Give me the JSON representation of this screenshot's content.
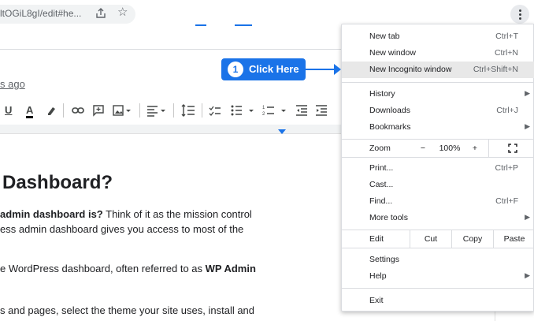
{
  "browser": {
    "url_text": "ltOGiL8gI/edit#he...",
    "share_icon": "share-icon",
    "star_icon": "star-icon",
    "menu_button_icon": "more-vert-icon"
  },
  "doc": {
    "edit_time": "s ago",
    "heading": "Dashboard?",
    "p1_bold": "admin dashboard is?",
    "p1_rest": " Think of it as the mission control",
    "p1_line2": "ess admin dashboard gives you access to most of the",
    "p2_start": "e WordPress dashboard, often referred to as ",
    "p2_bold": "WP Admin",
    "p3": "s and pages, select the theme your site uses, install and"
  },
  "toolbar_icons": [
    "underline-icon",
    "text-color-icon",
    "highlight-icon",
    "link-icon",
    "comment-icon",
    "image-icon",
    "align-icon",
    "line-spacing-icon",
    "checklist-icon",
    "bullet-list-icon",
    "numbered-list-icon",
    "decrease-indent-icon",
    "increase-indent-icon"
  ],
  "callout": {
    "number": "1",
    "text": "Click Here",
    "color": "#1a73e8"
  },
  "menu": {
    "new_tab": {
      "label": "New tab",
      "shortcut": "Ctrl+T"
    },
    "new_window": {
      "label": "New window",
      "shortcut": "Ctrl+N"
    },
    "new_incognito": {
      "label": "New Incognito window",
      "shortcut": "Ctrl+Shift+N"
    },
    "history": {
      "label": "History"
    },
    "downloads": {
      "label": "Downloads",
      "shortcut": "Ctrl+J"
    },
    "bookmarks": {
      "label": "Bookmarks"
    },
    "zoom": {
      "label": "Zoom",
      "minus": "−",
      "value": "100%",
      "plus": "+"
    },
    "print": {
      "label": "Print...",
      "shortcut": "Ctrl+P"
    },
    "cast": {
      "label": "Cast..."
    },
    "find": {
      "label": "Find...",
      "shortcut": "Ctrl+F"
    },
    "more_tools": {
      "label": "More tools"
    },
    "edit": {
      "label": "Edit",
      "cut": "Cut",
      "copy": "Copy",
      "paste": "Paste"
    },
    "settings": {
      "label": "Settings"
    },
    "help": {
      "label": "Help"
    },
    "exit": {
      "label": "Exit"
    }
  }
}
